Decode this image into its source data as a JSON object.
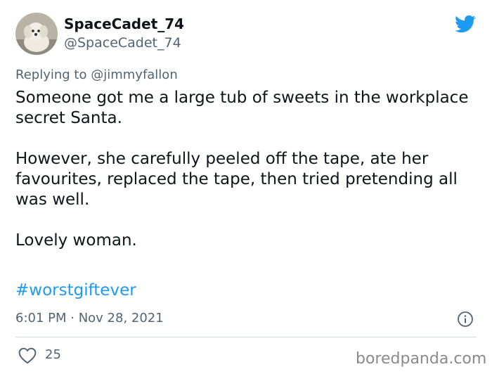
{
  "author": {
    "display_name": "SpaceCadet_74",
    "handle": "@SpaceCadet_74",
    "avatar_icon": "dog-avatar"
  },
  "reply": {
    "prefix": "Replying to",
    "mention": "@jimmyfallon"
  },
  "tweet": {
    "paragraphs": [
      "Someone got me a large tub of sweets in the workplace secret Santa.",
      "However, she carefully peeled off the tape, ate her favourites, replaced the tape, then tried pretending all was well.",
      "Lovely woman."
    ],
    "hashtag": "#worstgiftever",
    "timestamp": "6:01 PM · Nov 28, 2021"
  },
  "actions": {
    "like_count": "25"
  },
  "watermark": "boredpanda.com",
  "colors": {
    "twitter_blue": "#1d9bf0",
    "secondary_text": "#536471",
    "primary_text": "#0f1419"
  }
}
